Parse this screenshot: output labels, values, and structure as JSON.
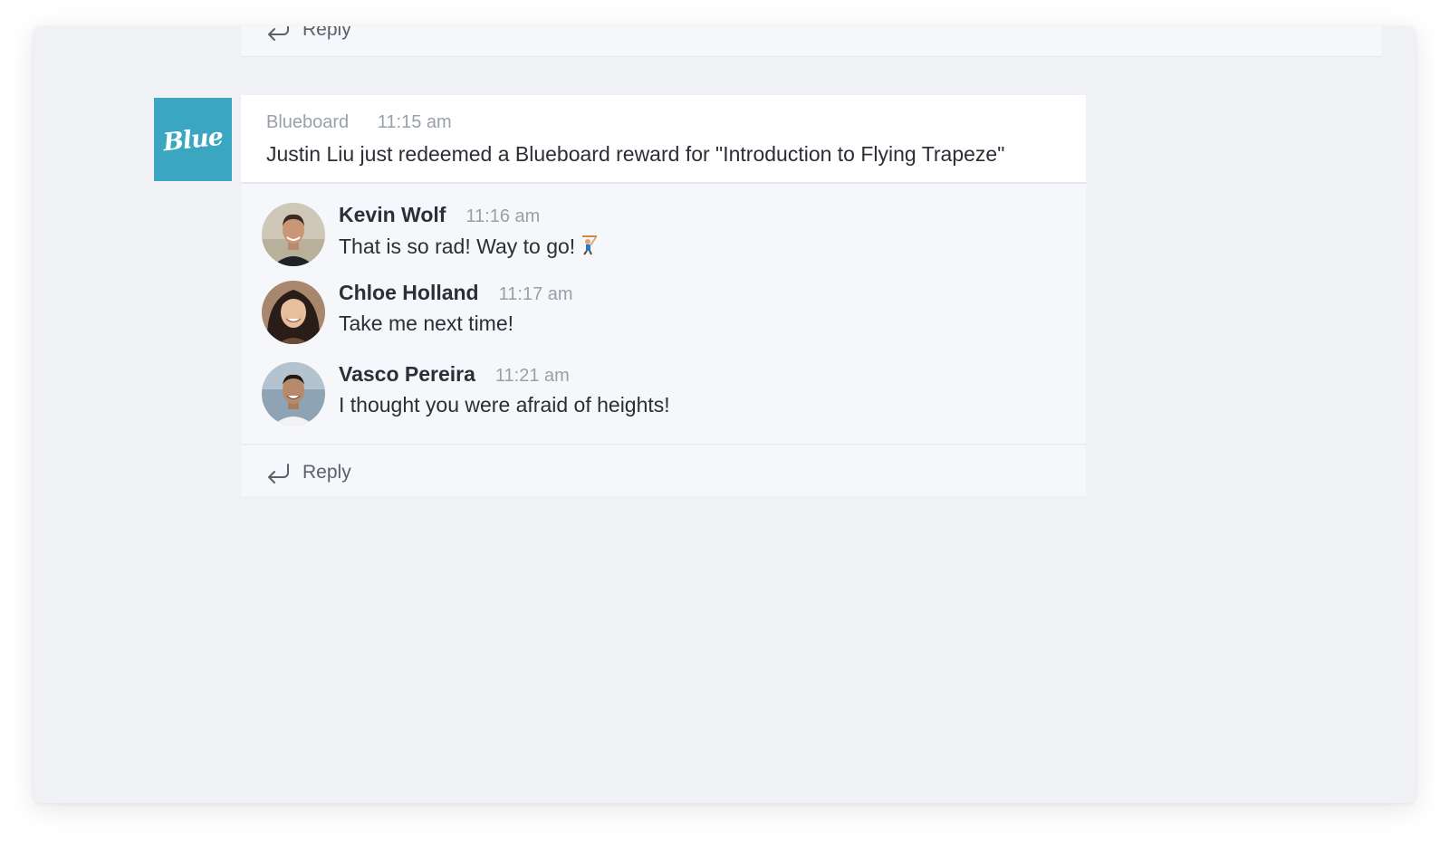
{
  "previous_thread": {
    "reply_label": "Reply"
  },
  "bot_message": {
    "sender": "Blueboard",
    "time": "11:15 am",
    "text": "Justin Liu just redeemed a Blueboard reward for \"Introduction to Flying Trapeze\"",
    "avatar_text": "Blueboard"
  },
  "replies": [
    {
      "name": "Kevin Wolf",
      "time": "11:16 am",
      "text": "That is so rad! Way to go!",
      "emoji": "trapeze-emoji"
    },
    {
      "name": "Chloe Holland",
      "time": "11:17 am",
      "text": "Take me next time!"
    },
    {
      "name": "Vasco Pereira",
      "time": "11:21 am",
      "text": "I thought you were afraid of heights!"
    }
  ],
  "thread": {
    "reply_label": "Reply"
  },
  "colors": {
    "brand": "#3aa6c2",
    "background": "#f0f1f4",
    "card": "#ffffff",
    "thread": "#f5f7fa"
  }
}
